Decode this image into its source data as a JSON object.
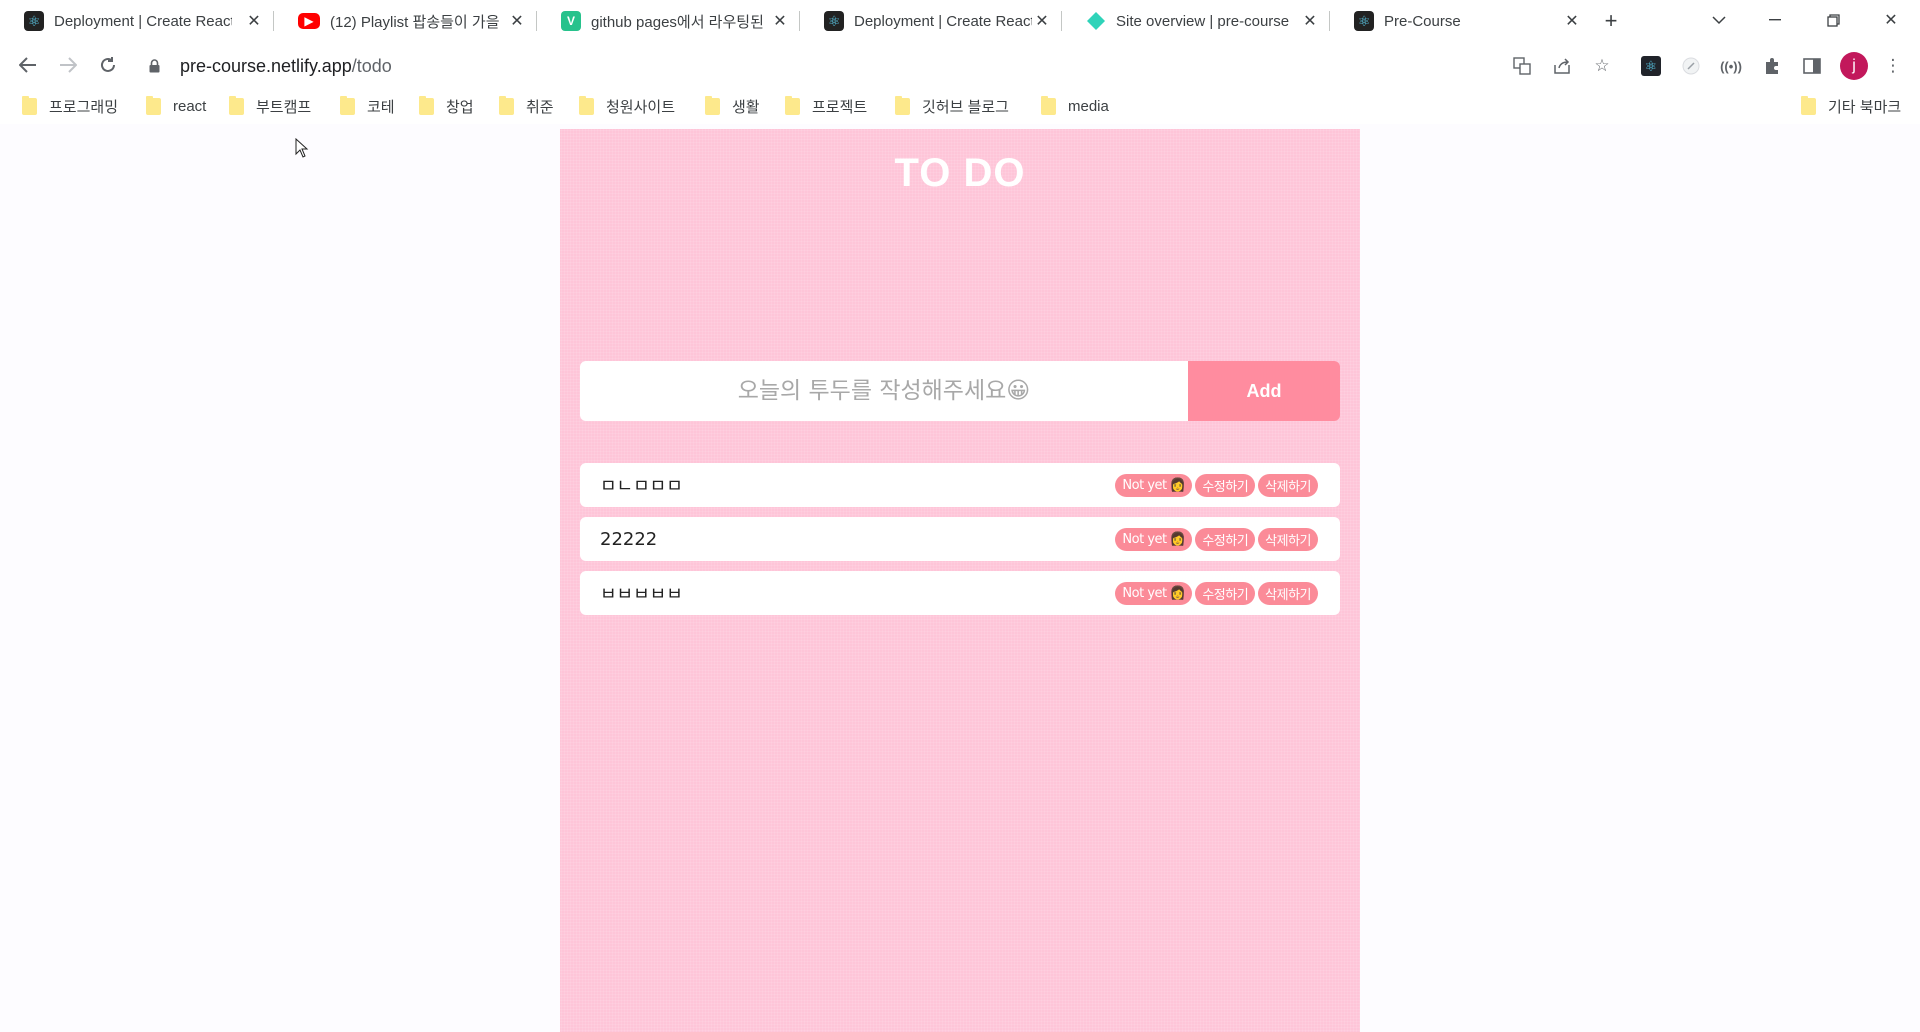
{
  "browser": {
    "tabs": [
      {
        "title": "Deployment | Create React",
        "favicon": "react-icon",
        "favicon_text": "⚛"
      },
      {
        "title": "(12) Playlist 팝송들이 가을",
        "favicon": "youtube-icon",
        "favicon_text": "▶"
      },
      {
        "title": "github pages에서 라우팅된",
        "favicon": "velog-icon",
        "favicon_text": "V"
      },
      {
        "title": "Deployment | Create React",
        "favicon": "react-icon",
        "favicon_text": "⚛"
      },
      {
        "title": "Site overview | pre-course",
        "favicon": "netlify-icon",
        "favicon_text": ""
      },
      {
        "title": "Pre-Course",
        "favicon": "react-icon",
        "favicon_text": "⚛"
      }
    ],
    "url_host": "pre-course.netlify.app",
    "url_path": "/todo",
    "profile_initial": "j",
    "bookmarks": [
      "프로그래밍",
      "react",
      "부트캠프",
      "코테",
      "창업",
      "취준",
      "청원사이트",
      "생활",
      "프로젝트",
      "깃허브 블로그",
      "media"
    ],
    "other_bookmarks": "기타 북마크"
  },
  "app": {
    "title": "TO DO",
    "input_placeholder": "오늘의 투두를 작성해주세요😀",
    "add_label": "Add",
    "todos": [
      {
        "text": "ㅁㄴㅁㅁㅁ",
        "status": "Not yet",
        "status_emoji": "👩",
        "edit_label": "수정하기",
        "delete_label": "삭제하기"
      },
      {
        "text": "22222",
        "status": "Not yet",
        "status_emoji": "👩",
        "edit_label": "수정하기",
        "delete_label": "삭제하기"
      },
      {
        "text": "ㅂㅂㅂㅂㅂ",
        "status": "Not yet",
        "status_emoji": "👩",
        "edit_label": "수정하기",
        "delete_label": "삭제하기"
      }
    ]
  },
  "colors": {
    "app_bg": "#fec5d8",
    "add_button": "#ff8c9f",
    "pill": "#fb8b98",
    "avatar": "#c2185b"
  }
}
